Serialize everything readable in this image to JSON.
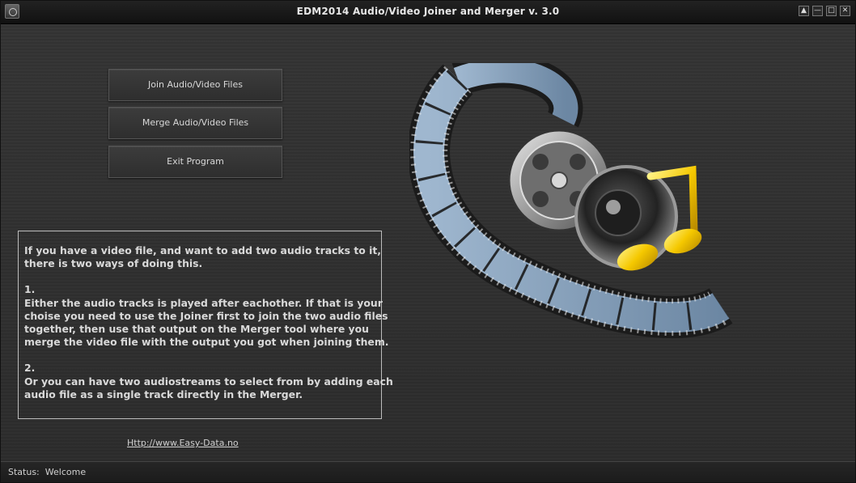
{
  "window": {
    "title": "EDM2014 Audio/Video Joiner and Merger v. 3.0",
    "controls": [
      "▲",
      "—",
      "□",
      "✕"
    ]
  },
  "buttons": {
    "join": "Join Audio/Video Files",
    "merge": "Merge Audio/Video Files",
    "exit": "Exit Program"
  },
  "info": {
    "lines": [
      "If you have a video file, and want to add two audio tracks to it,",
      "there is two ways of doing this.",
      "",
      "1.",
      "Either the audio tracks is played after eachother. If that is your",
      "choise you need to use the Joiner first to join the two audio files",
      "together, then use that output on the Merger tool where you",
      "merge the video file with the output you got when joining them.",
      "",
      "2.",
      "Or you can have two audiostreams to select from by adding each",
      "audio file as a single track directly in the Merger."
    ]
  },
  "link": "Http://www.Easy-Data.no",
  "status": {
    "label": "Status:",
    "value": "Welcome"
  },
  "icons": {
    "app": "app-icon",
    "art": "film-reel-music-note-icon"
  }
}
